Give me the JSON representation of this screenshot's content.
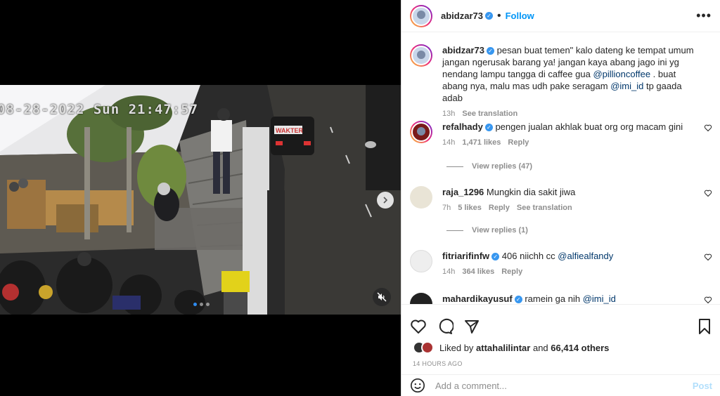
{
  "media": {
    "timestamp": "08-28-2022 Sun 21:47:57",
    "sign_text": "WAKTER",
    "next_icon": "chevron-right-icon",
    "mute_icon": "speaker-muted-icon"
  },
  "post": {
    "username": "abidzar73",
    "follow_label": "Follow",
    "more_icon": "ellipsis-icon"
  },
  "caption": {
    "username": "abidzar73",
    "text_1": "pesan buat temen\" kalo dateng ke tempat umum jangan ngerusak barang ya! jangan kaya abang jago ini yg nendang lampu tangga di caffee gua ",
    "mention_1": "@pillioncoffee",
    "text_2": " . buat abang nya, malu mas udh pake seragam ",
    "mention_2": "@imi_id",
    "text_3": " tp gaada adab",
    "time": "13h",
    "see_translation": "See translation"
  },
  "comments": [
    {
      "username": "refalhady",
      "verified": true,
      "text": "pengen jualan akhlak buat org org macam gini",
      "time": "14h",
      "likes": "1,471 likes",
      "reply": "Reply",
      "view_replies": "View replies (47)"
    },
    {
      "username": "raja_1296",
      "verified": false,
      "text": "Mungkin dia sakit jiwa",
      "time": "7h",
      "likes": "5 likes",
      "reply": "Reply",
      "see_translation": "See translation",
      "view_replies": "View replies (1)"
    },
    {
      "username": "fitriarifinfw",
      "verified": true,
      "text": "406 niichh cc ",
      "mention": "@alfiealfandy",
      "time": "14h",
      "likes": "364 likes",
      "reply": "Reply"
    },
    {
      "username": "mahardikayusuf",
      "verified": true,
      "text": "ramein ga nih ",
      "mention": "@imi_id"
    }
  ],
  "likes": {
    "prefix": "Liked by ",
    "user": "attahalilintar",
    "middle": " and ",
    "others": "66,414 others"
  },
  "post_time": "14 HOURS AGO",
  "add_comment": {
    "placeholder": "Add a comment...",
    "post_label": "Post"
  },
  "colors": {
    "link": "#0095f6",
    "verified": "#3897f0",
    "mention": "#00376b"
  }
}
